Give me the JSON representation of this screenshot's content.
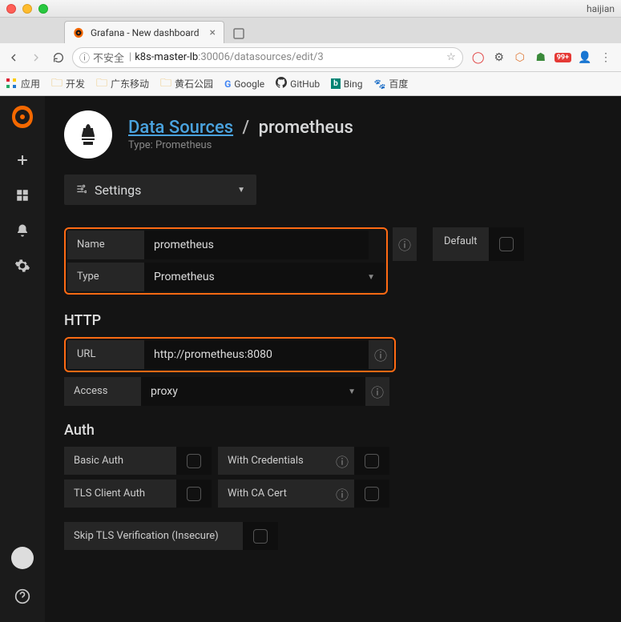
{
  "window": {
    "profile": "haijian"
  },
  "browser": {
    "tab_title": "Grafana - New dashboard",
    "url_insecure_label": "不安全",
    "url_host": "k8s-master-lb",
    "url_path": ":30006/datasources/edit/3",
    "badge": "99+",
    "bookmarks": {
      "apps": "应用",
      "dev": "开发",
      "gd": "广东移动",
      "hs": "黄石公园",
      "google": "Google",
      "github": "GitHub",
      "bing": "Bing",
      "baidu": "百度"
    }
  },
  "page": {
    "breadcrumb_root": "Data Sources",
    "breadcrumb_current": "prometheus",
    "subtitle": "Type: Prometheus",
    "tab": "Settings",
    "fields": {
      "name_label": "Name",
      "name_value": "prometheus",
      "default_label": "Default",
      "type_label": "Type",
      "type_value": "Prometheus"
    },
    "http": {
      "section": "HTTP",
      "url_label": "URL",
      "url_value": "http://prometheus:8080",
      "access_label": "Access",
      "access_value": "proxy"
    },
    "auth": {
      "section": "Auth",
      "basic": "Basic Auth",
      "with_credentials": "With Credentials",
      "tls_client": "TLS Client Auth",
      "with_ca": "With CA Cert",
      "skip_tls": "Skip TLS Verification (Insecure)"
    }
  }
}
